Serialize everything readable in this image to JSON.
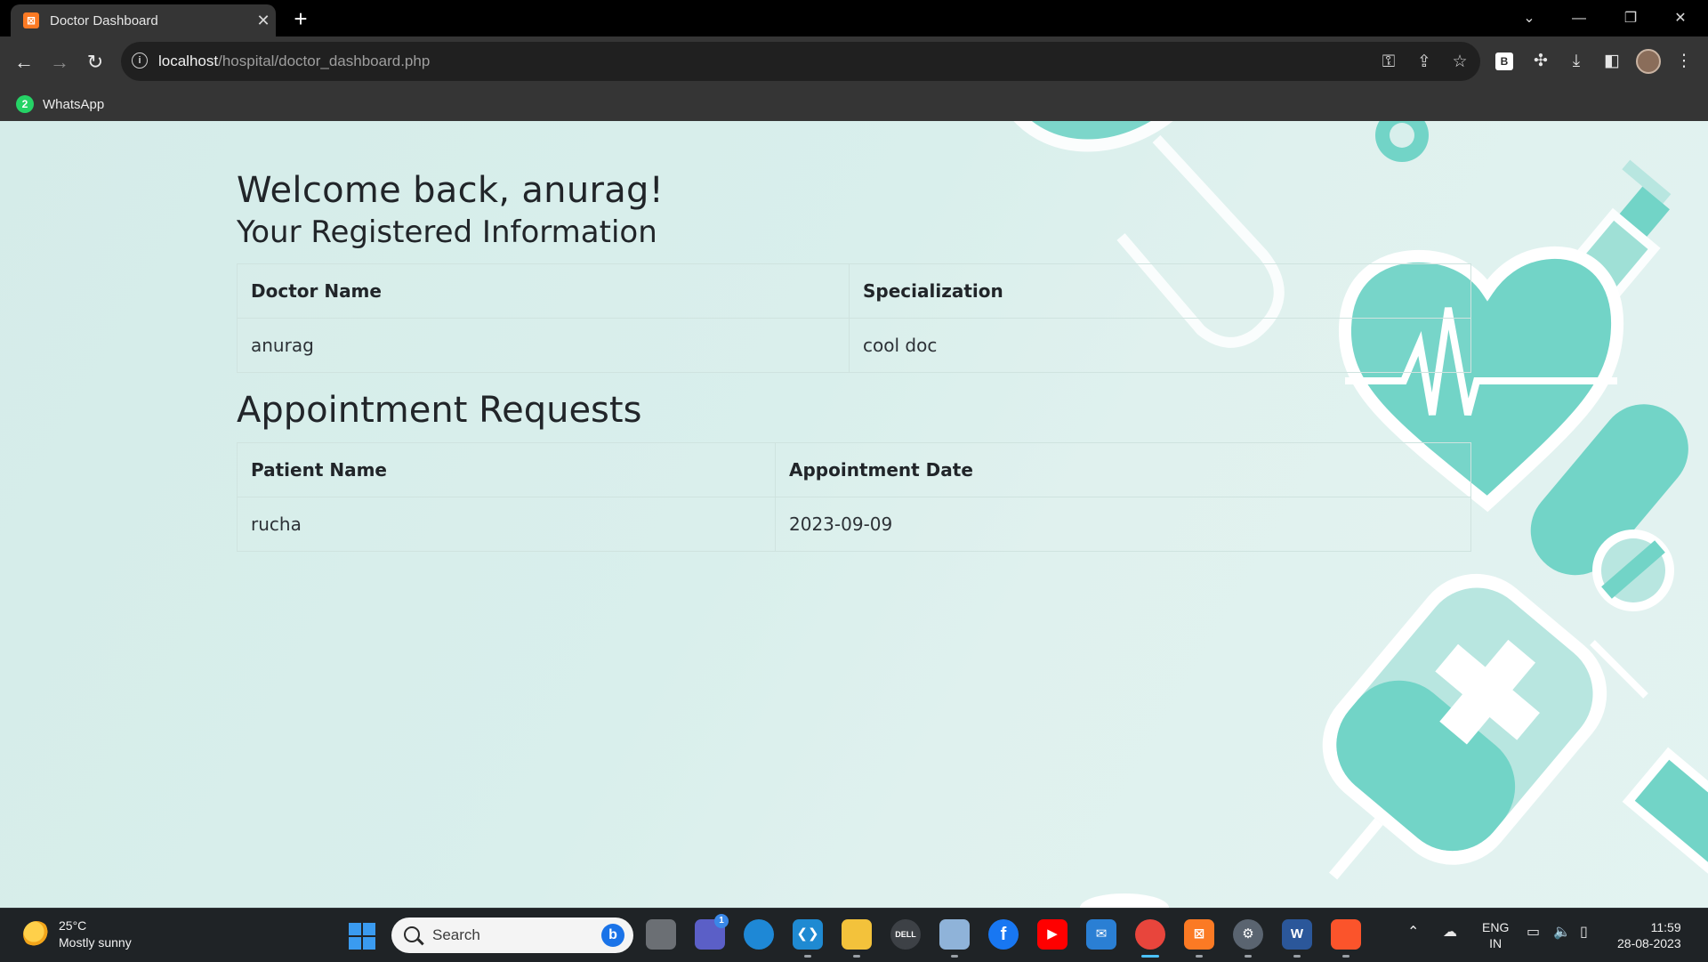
{
  "browser": {
    "tab": {
      "title": "Doctor Dashboard",
      "favicon": "xampp-icon"
    },
    "new_tab_label": "+",
    "url_host": "localhost",
    "url_path": "/hospital/doctor_dashboard.php",
    "bookmarks": [
      {
        "label": "WhatsApp",
        "icon": "whatsapp-icon",
        "badge": "2"
      }
    ],
    "extension_label": "B"
  },
  "page": {
    "welcome": "Welcome back, anurag!",
    "registered_heading": "Your Registered Information",
    "doctor_table": {
      "headers": [
        "Doctor Name",
        "Specialization"
      ],
      "rows": [
        [
          "anurag",
          "cool doc"
        ]
      ]
    },
    "appointments_heading": "Appointment Requests",
    "appointments_table": {
      "headers": [
        "Patient Name",
        "Appointment Date"
      ],
      "rows": [
        [
          "rucha",
          "2023-09-09"
        ]
      ]
    },
    "accent_color": "#72d4c7"
  },
  "taskbar": {
    "weather": {
      "temp": "25°C",
      "condition": "Mostly sunny"
    },
    "search_placeholder": "Search",
    "teams_badge": "1",
    "lang_top": "ENG",
    "lang_bottom": "IN",
    "time": "11:59",
    "date": "28-08-2023"
  }
}
